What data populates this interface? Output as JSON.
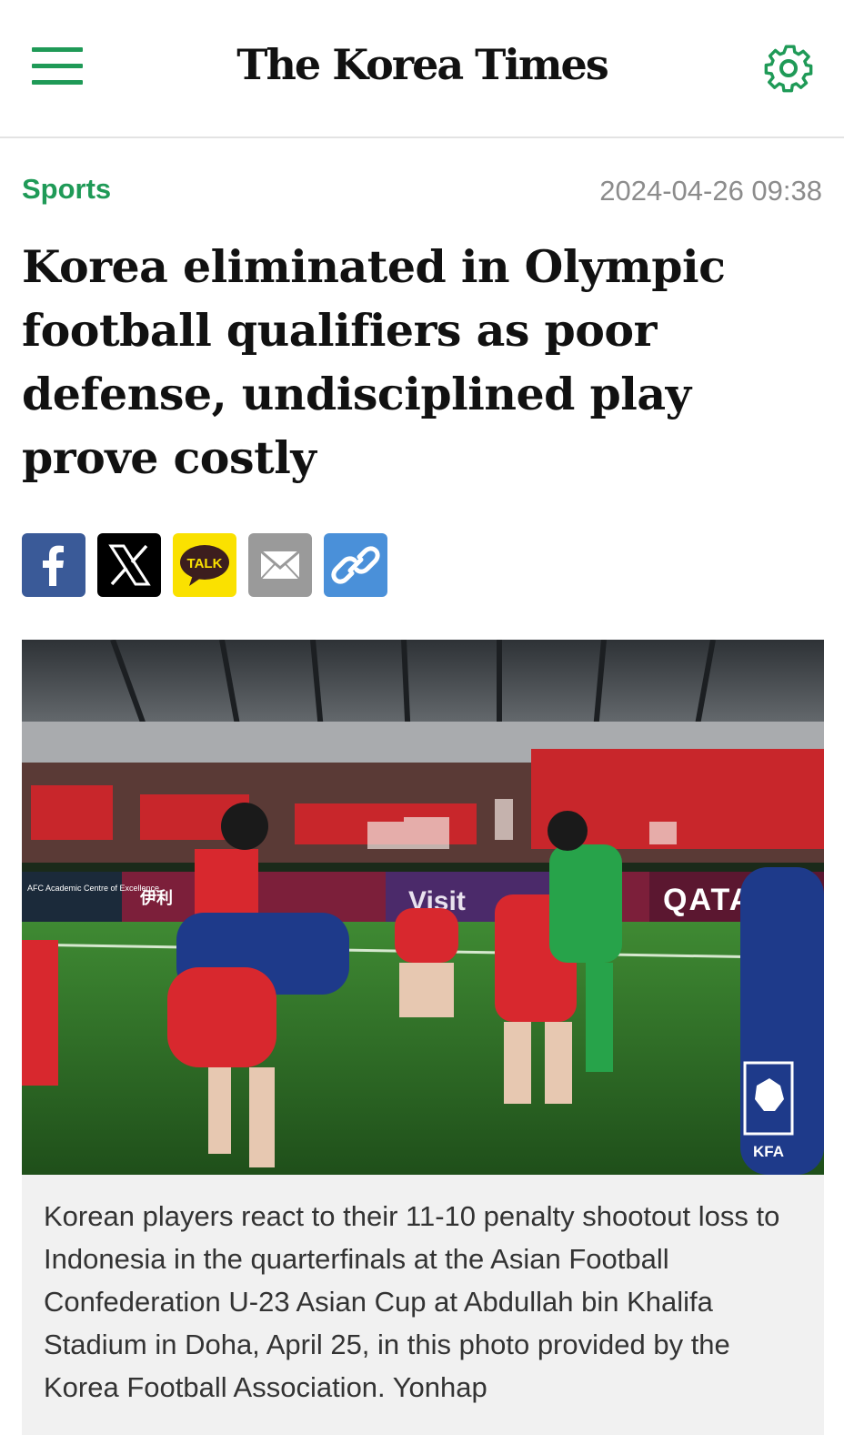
{
  "header": {
    "brand": "The Korea Times",
    "menu_icon": "hamburger-menu-icon",
    "settings_icon": "gear-icon",
    "accent": "#1f9a57"
  },
  "article": {
    "section": "Sports",
    "date": "2024-04-26 09:38",
    "headline": "Korea eliminated in Olympic football qualifiers as poor defense, undisciplined play prove costly"
  },
  "share": {
    "buttons": [
      {
        "icon": "facebook-icon",
        "color": "#3a5a98"
      },
      {
        "icon": "x-icon",
        "color": "#000000"
      },
      {
        "icon": "kakaotalk-icon",
        "label": "TALK",
        "color": "#fae100"
      },
      {
        "icon": "email-icon",
        "color": "#9a9a9a"
      },
      {
        "icon": "link-icon",
        "color": "#4a90d9"
      }
    ]
  },
  "photo": {
    "board_left": "AFC Academic Centre of Excellence",
    "board_brand": "伊利",
    "board_visit": "Visit",
    "board_qatar": "QATAR",
    "watermark": "KFA"
  },
  "caption": "Korean players react to their 11-10 penalty shootout loss to Indonesia in the quarterfinals at the Asian Football Confederation U-23 Asian Cup at Abdullah bin Khalifa Stadium in Doha, April 25, in this photo provided by the Korea Football Association. Yonhap"
}
